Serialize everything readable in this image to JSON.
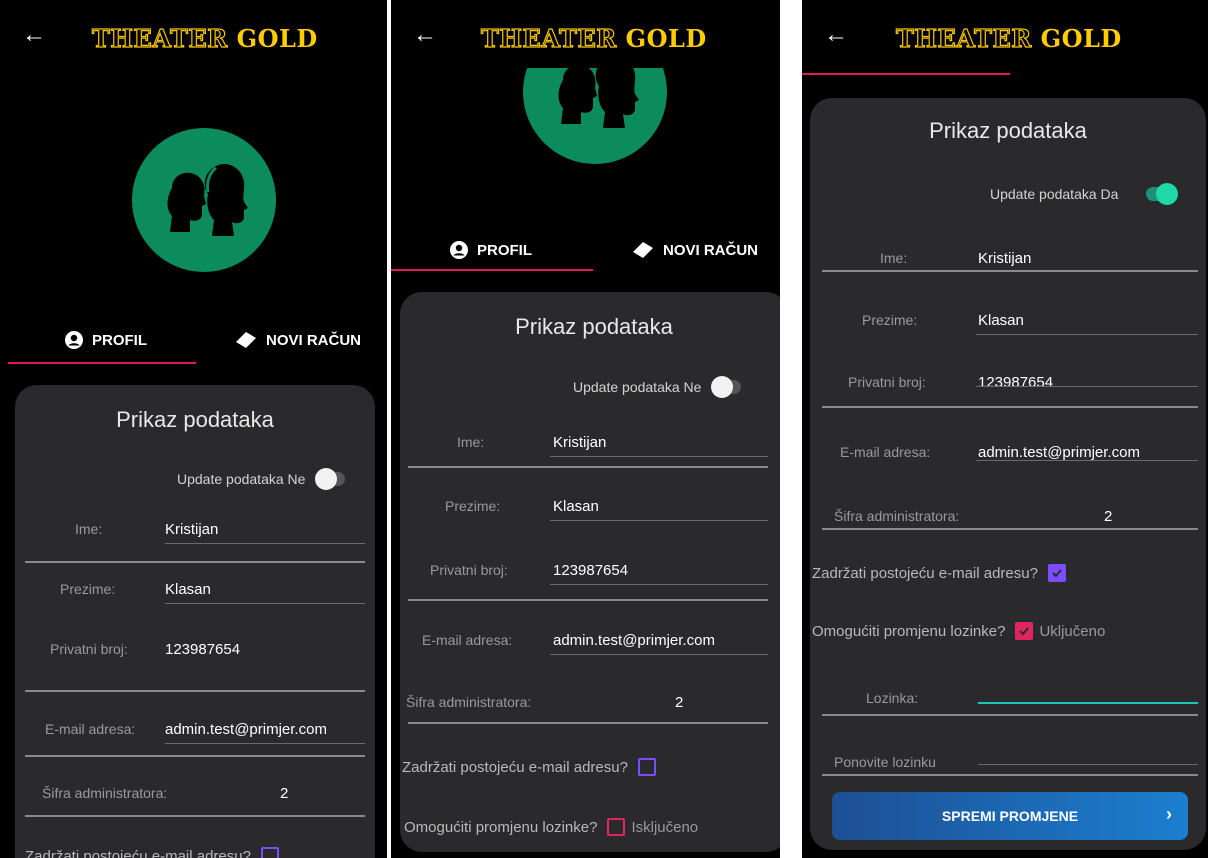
{
  "app": {
    "title_part1": "THEATER",
    "title_part2": "GOLD"
  },
  "tabs": {
    "profil": "PROFIL",
    "novi_racun": "NOVI RAČUN"
  },
  "card": {
    "title": "Prikaz podataka",
    "update_label": "Update podataka",
    "update_value_off": "Ne",
    "update_value_on": "Da"
  },
  "fields": {
    "ime_label": "Ime:",
    "ime_value": "Kristijan",
    "prezime_label": "Prezime:",
    "prezime_value": "Klasan",
    "privatni_label": "Privatni broj:",
    "privatni_value": "123987654",
    "email_label": "E-mail adresa:",
    "email_value": "admin.test@primjer.com",
    "sifra_label": "Šifra administratora:",
    "sifra_value": "2"
  },
  "checks": {
    "zadrzati_label": "Zadržati postojeću e-mail adresu?",
    "omoguciti_label": "Omogućiti promjenu lozinke?",
    "state_off": "Isključeno",
    "state_on": "Uključeno"
  },
  "password": {
    "lozinka_label": "Lozinka:",
    "ponovite_label": "Ponovite lozinku"
  },
  "save_button": {
    "label": "SPREMI PROMJENE"
  },
  "colors": {
    "accent_pink": "#e2175f",
    "avatar_green": "#0c8b5d",
    "checkbox_purple": "#7c4dff",
    "logo_gold": "#ffcc00"
  },
  "icons": [
    "arrow-left-icon",
    "user-circle-icon",
    "ticket-icon",
    "check-icon",
    "chevron-right-icon"
  ]
}
